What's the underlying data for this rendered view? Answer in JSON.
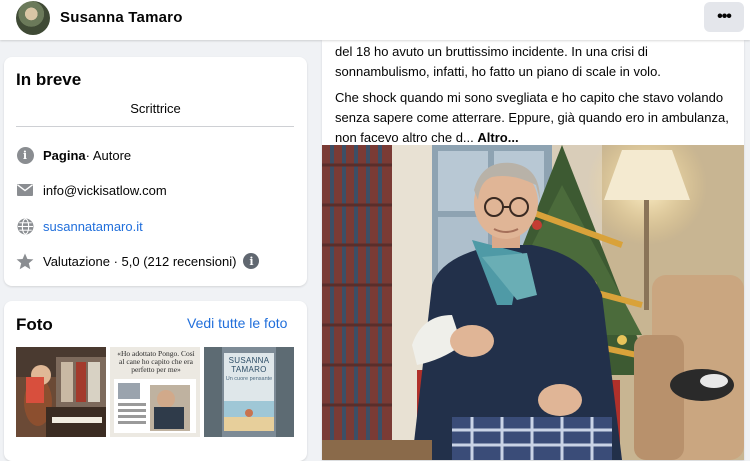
{
  "header": {
    "page_name": "Susanna Tamaro",
    "more_label": "•••"
  },
  "intro": {
    "title": "In breve",
    "bio": "Scrittrice",
    "rows": [
      {
        "icon": "info-icon",
        "strong": "Pagina",
        "text": " · Autore"
      },
      {
        "icon": "mail-icon",
        "text": "info@vickisatlow.com"
      },
      {
        "icon": "globe-icon",
        "text": "susannatamaro.it"
      },
      {
        "icon": "star-icon",
        "text": "Valutazione · 5,0 (212 recensioni)"
      }
    ],
    "info_glyph": "i"
  },
  "photos": {
    "title": "Foto",
    "see_all": "Vedi tutte le foto",
    "thumb2_caption": "«Ho adottato Pongo. Così al cane ho capito che era perfetto per me»",
    "thumb3_title_1": "SUSANNA",
    "thumb3_title_2": "TAMARO",
    "thumb3_subtitle": "Un cuore pensante"
  },
  "post": {
    "paragraph1": "del 18 ho avuto un bruttissimo incidente. In una crisi di sonnambulismo, infatti, ho fatto un piano di scale in volo.",
    "paragraph2": "Che shock quando mi sono svegliata e ho capito che stavo volando senza sapere come atterrare. Eppure, già quando ero in ambulanza, non facevo altro che d...",
    "more_link": "Altro..."
  },
  "colors": {
    "link": "#216fdb",
    "background": "#f0f2f5"
  }
}
